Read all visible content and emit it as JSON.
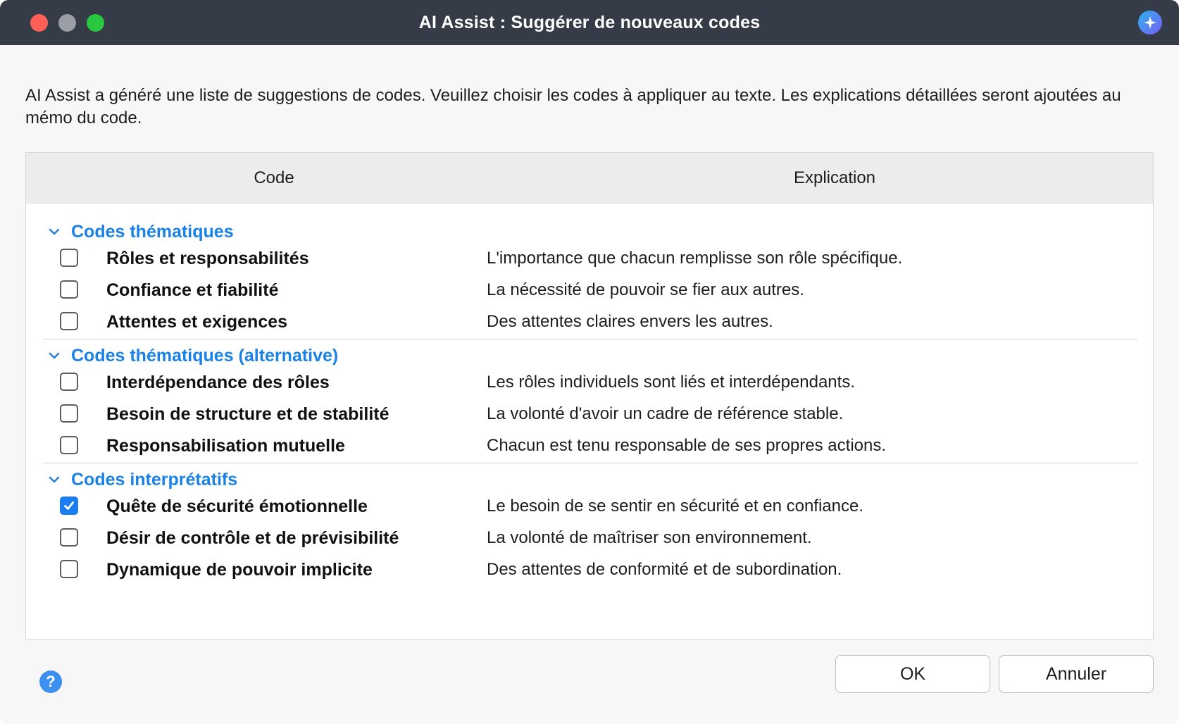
{
  "window": {
    "title": "AI Assist : Suggérer de nouveaux codes"
  },
  "intro_text": "AI Assist a généré une liste de suggestions de codes. Veuillez choisir les codes à appliquer au texte. Les explications détaillées seront ajoutées au mémo du code.",
  "table": {
    "columns": [
      "Code",
      "Explication"
    ],
    "groups": [
      {
        "label": "Codes thématiques",
        "rows": [
          {
            "code": "Rôles et responsabilités",
            "explanation": "L'importance que chacun remplisse son rôle spécifique.",
            "checked": false
          },
          {
            "code": "Confiance et fiabilité",
            "explanation": "La nécessité de pouvoir se fier aux autres.",
            "checked": false
          },
          {
            "code": "Attentes et exigences",
            "explanation": "Des attentes claires envers les autres.",
            "checked": false
          }
        ]
      },
      {
        "label": "Codes thématiques (alternative)",
        "rows": [
          {
            "code": "Interdépendance des rôles",
            "explanation": "Les rôles individuels sont liés et interdépendants.",
            "checked": false
          },
          {
            "code": "Besoin de structure et de stabilité",
            "explanation": "La volonté d'avoir un cadre de référence stable.",
            "checked": false
          },
          {
            "code": "Responsabilisation mutuelle",
            "explanation": "Chacun est tenu responsable de ses propres actions.",
            "checked": false
          }
        ]
      },
      {
        "label": "Codes interprétatifs",
        "rows": [
          {
            "code": "Quête de sécurité émotionnelle",
            "explanation": "Le besoin de se sentir en sécurité et en confiance.",
            "checked": true
          },
          {
            "code": "Désir de contrôle et de prévisibilité",
            "explanation": "La volonté de maîtriser son environnement.",
            "checked": false
          },
          {
            "code": "Dynamique de pouvoir implicite",
            "explanation": "Des attentes de conformité et de subordination.",
            "checked": false
          }
        ]
      }
    ]
  },
  "buttons": {
    "ok": "OK",
    "cancel": "Annuler",
    "help": "?"
  },
  "colors": {
    "titlebar": "#353b47",
    "group_label": "#1a82e6",
    "checkbox_checked": "#1a7ef2"
  }
}
